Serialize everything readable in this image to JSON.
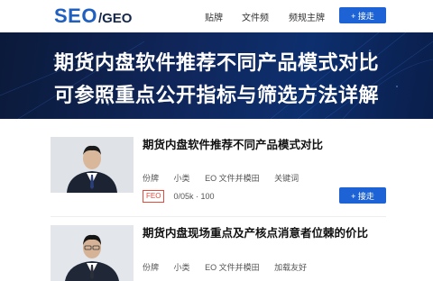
{
  "header": {
    "logo_main": "SEO",
    "logo_sub": "/GEO",
    "nav": [
      "贴牌",
      "文件频",
      "频规主牌"
    ],
    "cta_label": "+ 接走"
  },
  "hero": {
    "line1": "期货内盘软件推荐不同产品模式对比",
    "line2": "可参照重点公开指标与筛选方法详解"
  },
  "articles": [
    {
      "title": "期货内盘软件推荐不同产品模式对比",
      "meta": [
        "份牌",
        "小类",
        "EO 文件并模田",
        "关键词"
      ],
      "badge": "FEO",
      "stats": "0/05k · 100",
      "button": "+ 接走"
    },
    {
      "title": "期货内盘现场重点及产核点消意者位棘的价比",
      "meta": [
        "份牌",
        "小类",
        "EO 文件并模田",
        "加载友好"
      ]
    }
  ],
  "colors": {
    "brand_blue": "#1f5fbf",
    "button_blue": "#1d63d6",
    "hero_dark": "#0b1a3a",
    "badge_red": "#e34a3a"
  }
}
